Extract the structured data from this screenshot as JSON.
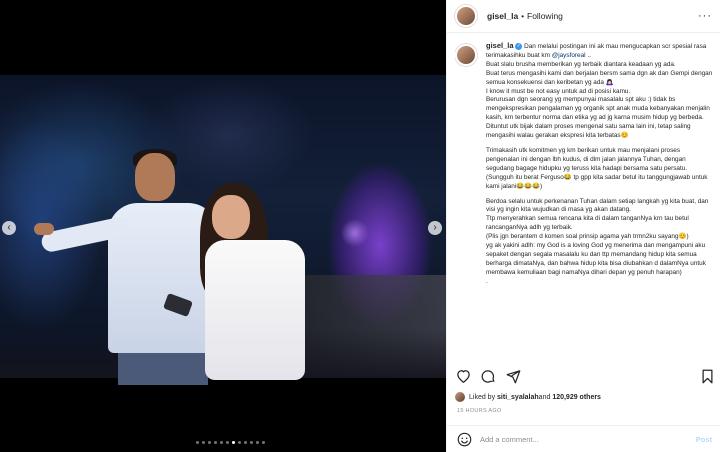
{
  "media": {
    "carousel_dots": 12,
    "active_dot": 6,
    "prev_icon": "chevron-left-icon",
    "next_icon": "chevron-right-icon",
    "prev_glyph": "‹",
    "next_glyph": "›"
  },
  "header": {
    "username": "gisel_la",
    "separator": "•",
    "follow_status": "Following",
    "more_glyph": "···"
  },
  "caption": {
    "username": "gisel_la",
    "verified_glyph": "✓",
    "intro": " Dan melalui postingan ini ak mau mengucapkan scr spesial rasa terimakasihku buat km ",
    "mention": "@jaysforeal",
    "intro_end": " ..",
    "paragraph1": "Buat slalu brusha memberikan yg terbaik diantara keadaan yg ada.\nBuat terus mengasihi kami dan berjalan bersm sama dgn ak dan Gempi dengan semua konsekuensi dan keribetan yg ada 🙇🏻‍♀️\nI know it must be not easy untuk ad di posisi kamu.\nBerurusan dgn seorang yg mempunyai masalalu spt aku :) tidak bs mengekspresikan pengalaman yg organik spt anak muda kebanyakan menjalin kasih, krn terbentur norma dan etika yg ad jg karna musim hidup yg berbeda.\nDituntut utk bijak dalam proses mengenal satu sama lain ini, tetap saling mengasihi walau gerakan ekspresi kita terbatas😊",
    "paragraph2": "Trimakasih utk komitmen yg km berikan untuk mau menjalani proses pengenalan ini dengan lbh kudus, di dlm jalan jalannya Tuhan, dengan segudang bagage hidupku yg teruss kita hadapi bersama satu persatu.\n(Sungguh itu berat Ferguso😂 tp gpp kita sadar betul itu tanggungjawab untuk kami jalani😂😂😂)",
    "paragraph3": "Berdoa selalu untuk perkenanan Tuhan dalam setiap langkah yg kita buat, dan visi yg ingin kita wujudkan di masa yg akan datang.\nTtp menyerahkan semua rencana kita di dalam tanganNya krn tau betul rancanganNya adlh yg terbaik.\n(Plis jgn berantem d komen soal prinsip agama yah trmn2ku sayang😊)",
    "paragraph4": "yg ak yakini adlh: my God is a loving God yg menerima dan mengampuni aku sepaket dengan segala masalalu ku dan ttp memandang hidup kita semua berharga dimataNya, dan bahwa hidup kita bisa diubahkan d dalamNya untuk membawa kemuliaan bagi namaNya dihari depan yg penuh harapan)",
    "trailing": "."
  },
  "actions": {
    "like_icon": "heart-icon",
    "comment_icon": "comment-icon",
    "share_icon": "share-icon",
    "save_icon": "bookmark-icon"
  },
  "likes": {
    "prefix": "Liked by ",
    "user": "siti_syalalah",
    "middle": " and ",
    "count": "120,929 others"
  },
  "time": "15 HOURS AGO",
  "comment": {
    "emoji_icon": "smiley-icon",
    "placeholder": "Add a comment...",
    "post_label": "Post"
  }
}
